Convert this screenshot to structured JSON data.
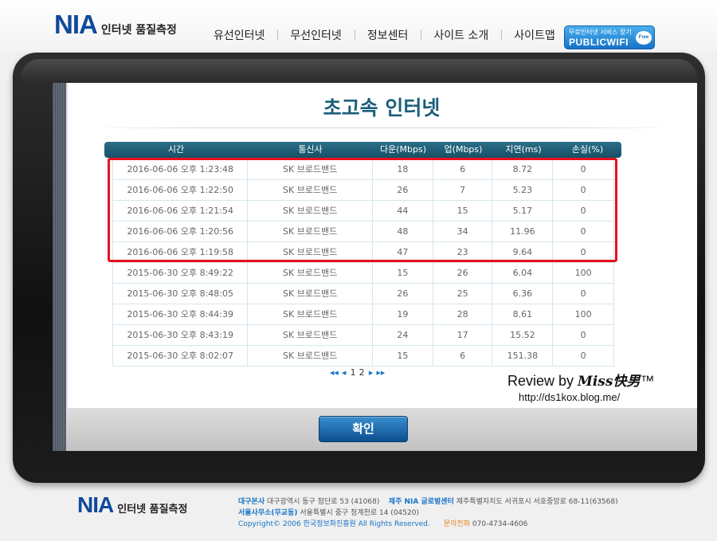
{
  "header": {
    "logo_main": "NIA",
    "logo_sub": "인터넷 품질측정",
    "nav": [
      "유선인터넷",
      "무선인터넷",
      "정보센터",
      "사이트 소개",
      "사이트맵"
    ],
    "public_wifi": {
      "line1": "무료인터넷 서비스 찾기",
      "line2": "PUBLICWIFI",
      "badge": "Free"
    }
  },
  "main": {
    "title": "초고속 인터넷",
    "table": {
      "columns": [
        "시간",
        "통신사",
        "다운(Mbps)",
        "업(Mbps)",
        "지연(ms)",
        "손실(%)"
      ],
      "rows": [
        [
          "2016-06-06 오후 1:23:48",
          "SK 브로드밴드",
          "18",
          "6",
          "8.72",
          "0"
        ],
        [
          "2016-06-06 오후 1:22:50",
          "SK 브로드밴드",
          "26",
          "7",
          "5.23",
          "0"
        ],
        [
          "2016-06-06 오후 1:21:54",
          "SK 브로드밴드",
          "44",
          "15",
          "5.17",
          "0"
        ],
        [
          "2016-06-06 오후 1:20:56",
          "SK 브로드밴드",
          "48",
          "34",
          "11.96",
          "0"
        ],
        [
          "2016-06-06 오후 1:19:58",
          "SK 브로드밴드",
          "47",
          "23",
          "9.64",
          "0"
        ],
        [
          "2015-06-30 오후 8:49:22",
          "SK 브로드밴드",
          "15",
          "26",
          "6.04",
          "100"
        ],
        [
          "2015-06-30 오후 8:48:05",
          "SK 브로드밴드",
          "26",
          "25",
          "6.36",
          "0"
        ],
        [
          "2015-06-30 오후 8:44:39",
          "SK 브로드밴드",
          "19",
          "28",
          "8.61",
          "100"
        ],
        [
          "2015-06-30 오후 8:43:19",
          "SK 브로드밴드",
          "24",
          "17",
          "15.52",
          "0"
        ],
        [
          "2015-06-30 오후 8:02:07",
          "SK 브로드밴드",
          "15",
          "6",
          "151.38",
          "0"
        ]
      ]
    },
    "pagination": {
      "pages": [
        "1",
        "2"
      ]
    },
    "watermark": {
      "line1_prefix": "Review by ",
      "signature": "Miss快男",
      "tm": "™",
      "line2": "http://ds1kox.blog.me/"
    },
    "confirm_button": "확인"
  },
  "footer": {
    "logo_main": "NIA",
    "logo_sub": "인터넷 품질측정",
    "line1_label_a": "대구본사",
    "line1_text_a": " 대구광역시 동구 첨단로 53 (41068)",
    "line1_label_b": "제주 NIA 글로벌센터",
    "line1_text_b": " 제주특별자치도 서귀포시 서호중앙로 68-11(63568)",
    "line2_label": "서울사무소(무교동)",
    "line2_text": " 서울특별시 중구 청계천로 14 (04520)",
    "copyright": "Copyright© 2006 한국정보화진흥원 All Rights Reserved.",
    "contact_label": "문의전화",
    "contact_number": " 070-4734-4606"
  },
  "colors": {
    "brand_blue": "#0f4a9c",
    "table_header": "#155167",
    "highlight_red": "#e8101c",
    "title_teal": "#1b5e7a"
  }
}
